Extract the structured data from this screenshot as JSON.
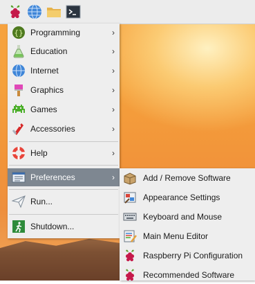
{
  "taskbar": {
    "icons": [
      "raspberry-menu-icon",
      "web-browser-icon",
      "file-manager-icon",
      "terminal-icon"
    ]
  },
  "main_menu": {
    "items": [
      {
        "label": "Programming",
        "icon": "programming-icon",
        "has_submenu": true
      },
      {
        "label": "Education",
        "icon": "education-icon",
        "has_submenu": true
      },
      {
        "label": "Internet",
        "icon": "internet-icon",
        "has_submenu": true
      },
      {
        "label": "Graphics",
        "icon": "graphics-icon",
        "has_submenu": true
      },
      {
        "label": "Games",
        "icon": "games-icon",
        "has_submenu": true
      },
      {
        "label": "Accessories",
        "icon": "accessories-icon",
        "has_submenu": true
      },
      {
        "label": "Help",
        "icon": "help-icon",
        "has_submenu": true
      },
      {
        "label": "Preferences",
        "icon": "preferences-icon",
        "has_submenu": true,
        "active": true
      },
      {
        "label": "Run...",
        "icon": "run-icon",
        "has_submenu": false
      },
      {
        "label": "Shutdown...",
        "icon": "shutdown-icon",
        "has_submenu": false
      }
    ],
    "submenu_arrow": "›"
  },
  "preferences_submenu": {
    "items": [
      {
        "label": "Add / Remove Software",
        "icon": "package-icon"
      },
      {
        "label": "Appearance Settings",
        "icon": "appearance-icon"
      },
      {
        "label": "Keyboard and Mouse",
        "icon": "keyboard-icon"
      },
      {
        "label": "Main Menu Editor",
        "icon": "menu-editor-icon"
      },
      {
        "label": "Raspberry Pi Configuration",
        "icon": "raspberry-icon"
      },
      {
        "label": "Recommended Software",
        "icon": "raspberry-icon"
      }
    ]
  },
  "colors": {
    "menu_bg": "#eeeeee",
    "highlight": "#7e8791",
    "taskbar_bg": "#ececec"
  }
}
